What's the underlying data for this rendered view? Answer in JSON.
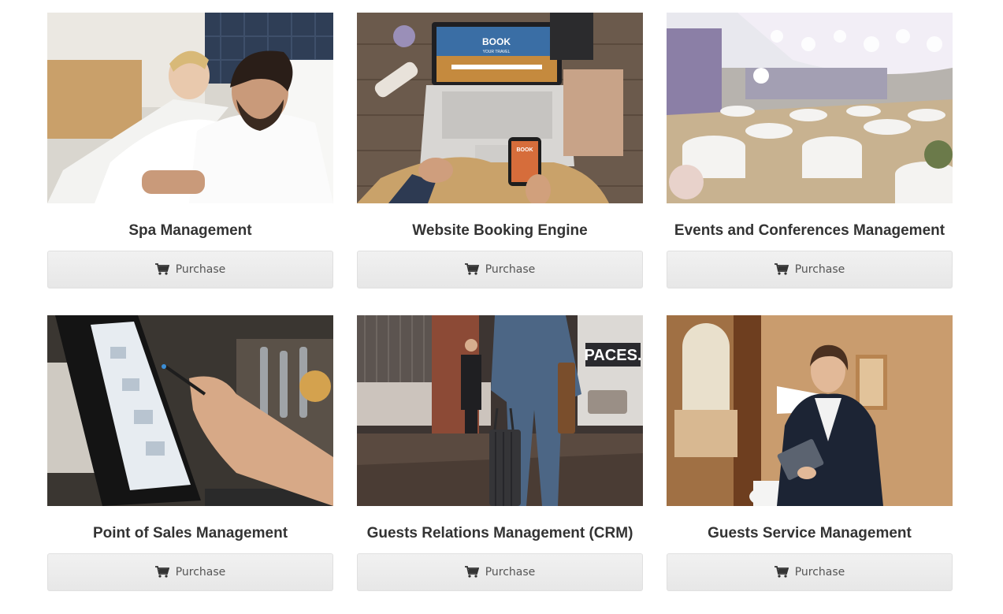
{
  "products": [
    {
      "title": "Spa Management",
      "button": "Purchase",
      "image": "spa-couple-relaxing-photo"
    },
    {
      "title": "Website Booking Engine",
      "button": "Purchase",
      "image": "laptop-phone-booking-photo"
    },
    {
      "title": "Events and Conferences Management",
      "button": "Purchase",
      "image": "banquet-hall-photo"
    },
    {
      "title": "Point of Sales Management",
      "button": "Purchase",
      "image": "pos-touchscreen-photo"
    },
    {
      "title": "Guests Relations Management (CRM)",
      "button": "Purchase",
      "image": "hotel-guest-luggage-photo"
    },
    {
      "title": "Guests Service Management",
      "button": "Purchase",
      "image": "hotel-staff-tablet-photo"
    }
  ],
  "photo_texts": {
    "laptop_screen": "BOOK",
    "laptop_sub": "YOUR TRAVEL",
    "phone_screen": "BOOK",
    "sign": "PACES."
  },
  "icons": {
    "button_icon": "cart-icon"
  },
  "colors": {
    "button_bg": "#eaeaea",
    "title": "#333333",
    "button_text": "#555555"
  }
}
